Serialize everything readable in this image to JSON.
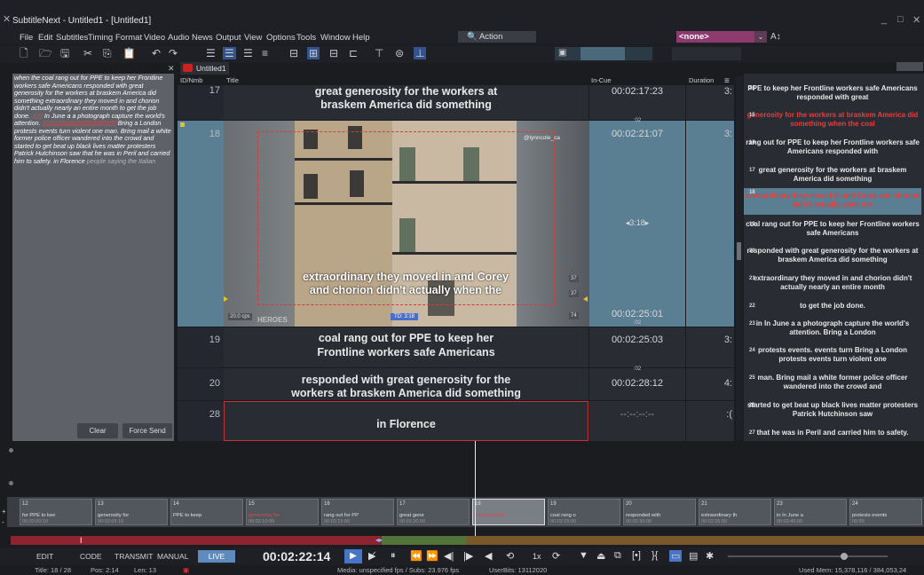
{
  "app": {
    "title": "SubtitleNext - Untitled1 - [Untitled1]"
  },
  "menu": [
    "File",
    "Edit",
    "Subtitles",
    "Timing",
    "Format",
    "Video",
    "Audio",
    "News",
    "Output",
    "View",
    "Options",
    "Tools",
    "Window",
    "Help"
  ],
  "search": {
    "action_label": "Action",
    "style_label": "<none>"
  },
  "left_panel": {
    "text_a": " when the coal rang out for PPE to keep her Frontline workers safe Americans responded with great generosity for the workers at braskem America did something extraordinary they moved in and chorion didn't actually nearly an entire month to get the job done.",
    "text_b": "In June a a photograph capture the world's attention.",
    "text_c": "Bring a London protests events turn violent one man. Bring mail a white former police officer wandered into the crowd and started to get beat up black lives matter protesters Patrick Hutchinson saw that he was in Peril and carried him to safety.",
    "text_d": "in Florence",
    "text_e": "people saying the Italian",
    "clear": "Clear",
    "force_send": "Force Send"
  },
  "tab": {
    "label": "Untitled1"
  },
  "grid": {
    "headers": {
      "id": "ID/Nmb",
      "title": "Title",
      "in_cue": "In-Cue",
      "duration": "Duration"
    },
    "rows": [
      {
        "id": "17",
        "line1": "great generosity for the workers at",
        "line2": "braskem America did something",
        "in_cue": "00:02:17:23",
        "dur": "3:"
      },
      {
        "id": "18",
        "in_cue": "00:02:21:07",
        "out_cue": "00:02:25:01",
        "dur": "3:",
        "mid": "◂3:18▸",
        "gap": ":02",
        "gap2": ":02"
      },
      {
        "id": "19",
        "line1": "coal rang out for PPE to keep her",
        "line2": "Frontline workers safe Americans",
        "in_cue": "00:02:25:03",
        "dur": "3:"
      },
      {
        "id": "20",
        "line1": "responded with great generosity for the",
        "line2": "workers at braskem America did something",
        "in_cue": "00:02:28:12",
        "dur": "4:",
        "gap": ":02"
      },
      {
        "id": "28",
        "line1": "in Florence",
        "in_cue": "--:--:--:--",
        "dur": ":("
      }
    ]
  },
  "video": {
    "handle": "@lynncole_ca",
    "sub1": "extraordinary they moved in and Corey",
    "sub2": "and chorion didn't actually  when the",
    "fps": "20.0 cps",
    "td": "TD: 3:18",
    "heroes": "HEROES",
    "tag1": "37",
    "tag2": "37",
    "tag3": "74"
  },
  "right_panel": [
    {
      "n": "14",
      "text": "PPE to keep her Frontline workers safe Americans responded with great",
      "red": false
    },
    {
      "n": "15",
      "text": "generosity for the workers at braskem America did something  when the coal",
      "red": true
    },
    {
      "n": "16",
      "text": "rang out for PPE to keep her Frontline workers safe Americans responded with",
      "red": false
    },
    {
      "n": "17",
      "text": "great generosity for the workers at braskem America did something",
      "red": false
    },
    {
      "n": "18",
      "text": "extraordinary they moved in and Corey and chorion didn't actually  when the",
      "red": true
    },
    {
      "n": "19",
      "text": "coal rang out for PPE to keep her Frontline workers safe Americans",
      "red": false
    },
    {
      "n": "20",
      "text": "responded with great generosity for the workers at braskem America did something",
      "red": false
    },
    {
      "n": "21",
      "text": "extraordinary they moved in and chorion didn't actually nearly an entire month",
      "red": false
    },
    {
      "n": "22",
      "text": "to get the job done.",
      "red": false
    },
    {
      "n": "23",
      "text": "in In June a a photograph capture the world's attention.  Bring a London",
      "red": false
    },
    {
      "n": "24",
      "text": "protests events. events turn  Bring a London protests events turn violent one",
      "red": false
    },
    {
      "n": "25",
      "text": "man. Bring mail a white former police officer wandered into the crowd and",
      "red": false
    },
    {
      "n": "26",
      "text": "started to get beat up black lives matter protesters Patrick Hutchinson saw",
      "red": false
    },
    {
      "n": "27",
      "text": "that he was in Peril and carried him to safety.",
      "red": false
    }
  ],
  "timeline": [
    {
      "t": "12",
      "txt": "for PPE to kee",
      "tm": "00:02:00:10"
    },
    {
      "t": "13",
      "txt": "generosity for",
      "tm": "00:02:05:10"
    },
    {
      "t": "14",
      "txt": "PPE to keep",
      "tm": ""
    },
    {
      "t": "15",
      "txt": "generosity for",
      "tm": "00:02:10:00",
      "red": true
    },
    {
      "t": "16",
      "txt": "rang out for PP",
      "tm": "00:02:15:00"
    },
    {
      "t": "17",
      "txt": "great gene",
      "tm": "00:02:20:00"
    },
    {
      "t": "18",
      "txt": "extraordinary",
      "tm": "",
      "red": true,
      "sel": true
    },
    {
      "t": "19",
      "txt": "coal rang o",
      "tm": "00:02:25:00"
    },
    {
      "t": "20",
      "txt": "responded with",
      "tm": "00:02:30:00"
    },
    {
      "t": "21",
      "txt": "extraordinary th",
      "tm": "00:02:35:00"
    },
    {
      "t": "23",
      "txt": "in In June a",
      "tm": "00:02:40:00"
    },
    {
      "t": "24",
      "txt": "protests events",
      "tm": "00:00"
    }
  ],
  "controls": {
    "edit": "EDIT",
    "code": "CODE",
    "transmit": "TRANSMIT",
    "manual": "MANUAL",
    "live": "LIVE",
    "timecode": "00:02:22:14",
    "speed": "1x"
  },
  "status": {
    "title": "Title: 18 / 28",
    "pos": "Pos: 2:14",
    "len": "Len: 13",
    "media": "Media: unspecified fps / Subs: 23.976 fps",
    "userbits": "UserBits: 13112020",
    "mem": "Used Mem: 15,378,116 / 384,053,24"
  },
  "colors": {
    "accent": "#5a7e92",
    "live": "#5e8bbd",
    "red_text": "#e53e3e",
    "style_badge": "#8d3a6f"
  }
}
